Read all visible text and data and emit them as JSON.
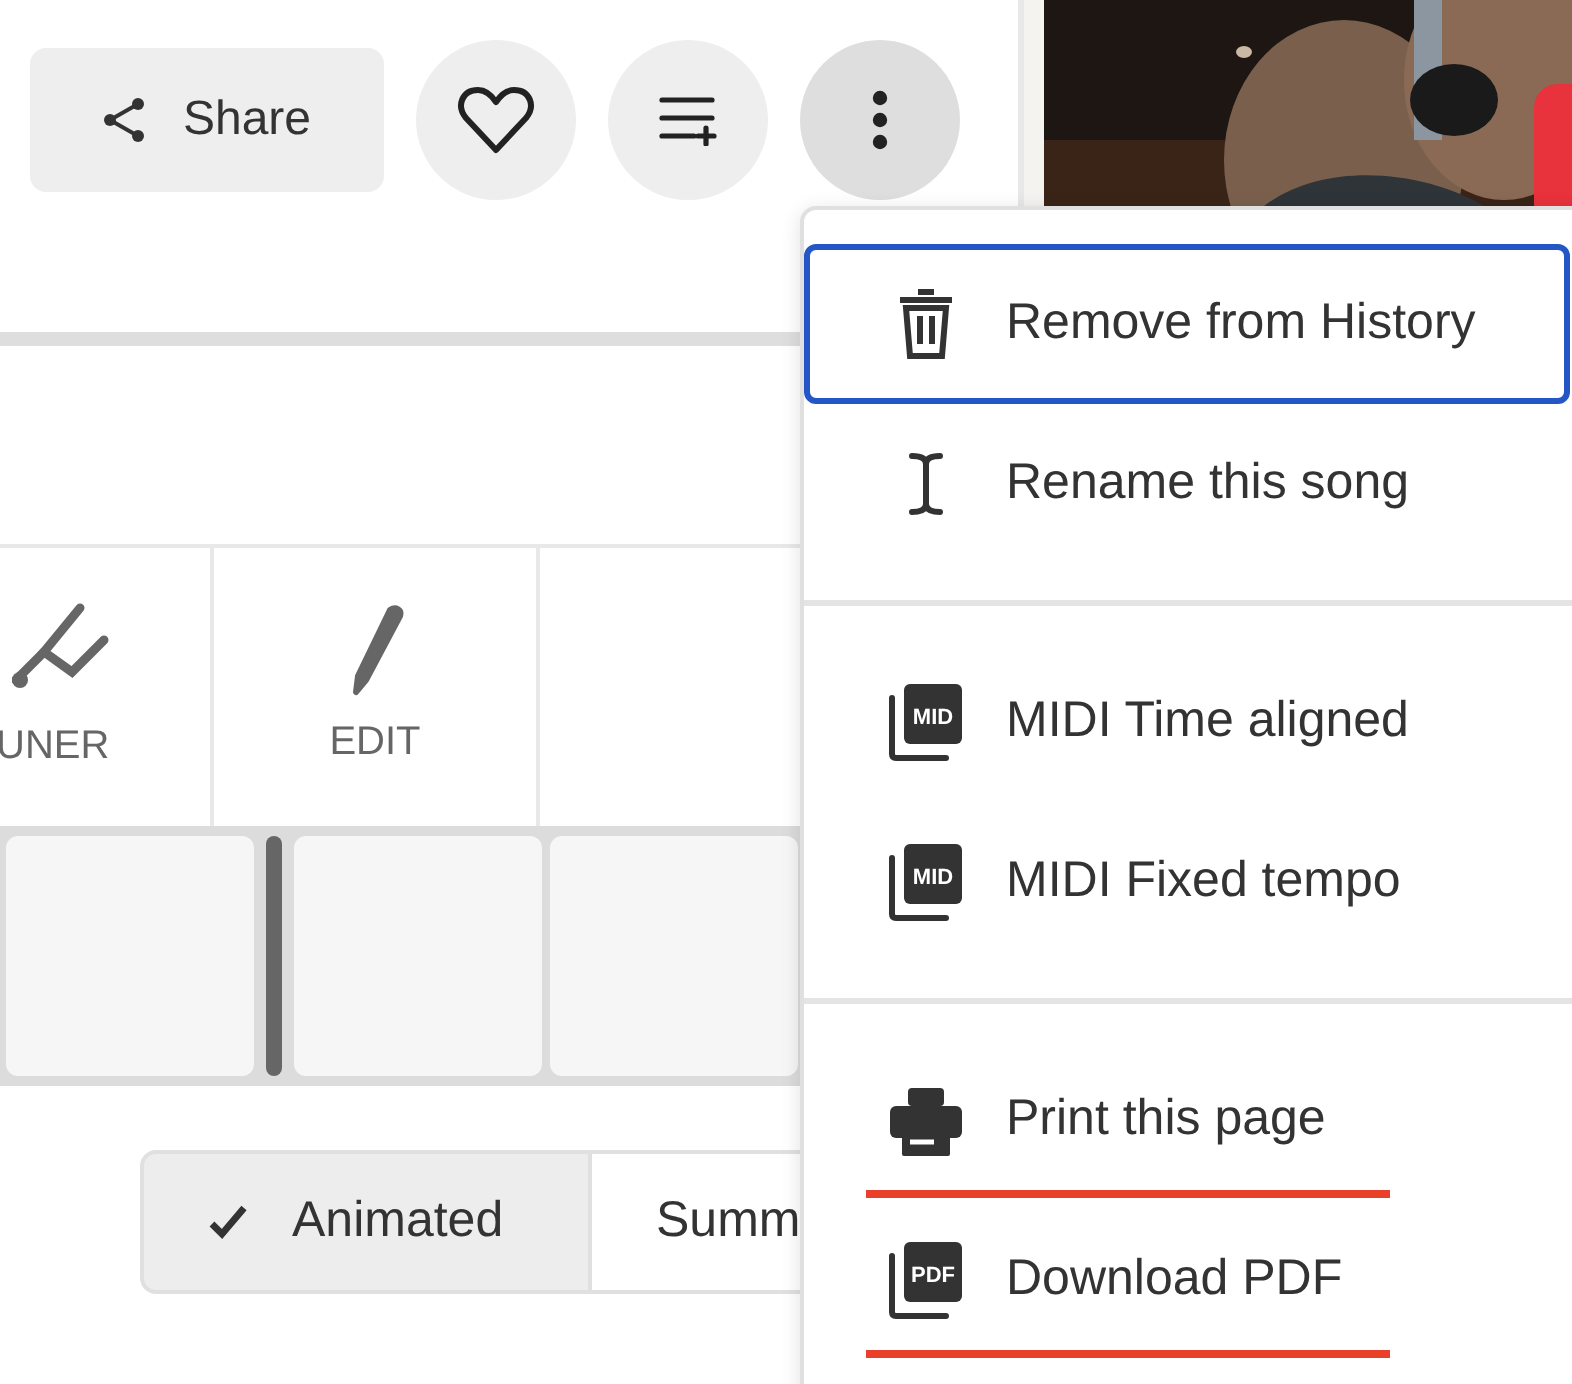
{
  "actions": {
    "share": {
      "label": "Share"
    },
    "favorite": {
      "selected": false
    },
    "more": {
      "expanded": true
    }
  },
  "tools": [
    {
      "kind": "tuner",
      "label": "UNER"
    },
    {
      "kind": "edit",
      "label": "EDIT"
    }
  ],
  "view_modes": [
    {
      "label": "Animated",
      "selected": true
    },
    {
      "label": "Summ",
      "selected": false
    }
  ],
  "menu": {
    "groups": [
      [
        {
          "kind": "trash",
          "label": "Remove from History",
          "focused": true,
          "underlined": false
        },
        {
          "kind": "cursor",
          "label": "Rename this song",
          "focused": false,
          "underlined": false
        }
      ],
      [
        {
          "kind": "file",
          "badge": "MID",
          "label": "MIDI Time aligned",
          "focused": false,
          "underlined": false
        },
        {
          "kind": "file",
          "badge": "MID",
          "label": "MIDI Fixed tempo",
          "focused": false,
          "underlined": false
        }
      ],
      [
        {
          "kind": "printer",
          "label": "Print this page",
          "focused": false,
          "underlined": true
        },
        {
          "kind": "file",
          "badge": "PDF",
          "label": "Download PDF",
          "focused": false,
          "underlined": true
        }
      ]
    ]
  }
}
